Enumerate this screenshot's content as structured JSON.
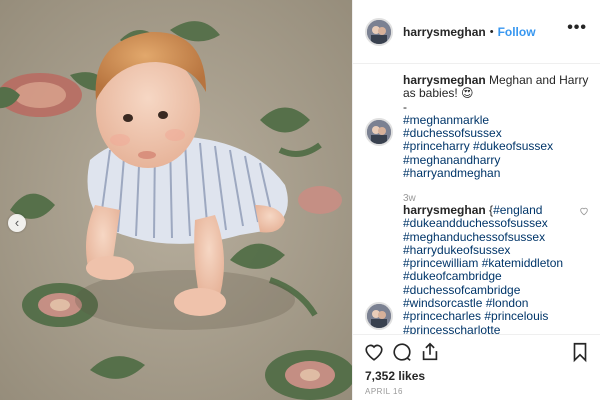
{
  "post": {
    "username": "harrysmeghan",
    "follow_label": "Follow",
    "separator": "•",
    "more_label": "•••"
  },
  "photo": {
    "alt": "baby crawling on patterned carpet",
    "carousel_prev": "‹"
  },
  "comments": [
    {
      "username": "harrysmeghan",
      "text": "Meghan and Harry as babies! 😍",
      "dash": "-",
      "tags": [
        "#meghanmarkle #duchessofsussex",
        "#princeharry #dukeofsussex",
        "#meghanandharry",
        "#harryandmeghan"
      ],
      "time": "3w"
    },
    {
      "username": "harrysmeghan",
      "prefix": "{",
      "tags": [
        "#england",
        "#dukeandduchessofsussex",
        "#meghanduchessofsussex",
        "#harrydukeofsussex",
        "#princewilliam #katemiddleton",
        "#dukeofcambridge",
        "#duchessofcambridge",
        "#windsorcastle #london",
        "#princecharles #princelouis",
        "#princesscharlotte"
      ]
    }
  ],
  "footer": {
    "likes": "7,352 likes",
    "date": "APRIL 16"
  },
  "icons": {
    "like": "heart-icon",
    "comment": "comment-icon",
    "share": "share-icon",
    "save": "bookmark-icon",
    "comment_like": "heart-icon",
    "more": "more-options-icon",
    "prev": "chevron-left-icon"
  },
  "colors": {
    "link": "#3897f0",
    "hashtag": "#003569",
    "muted": "#999999",
    "border": "#efefef"
  }
}
